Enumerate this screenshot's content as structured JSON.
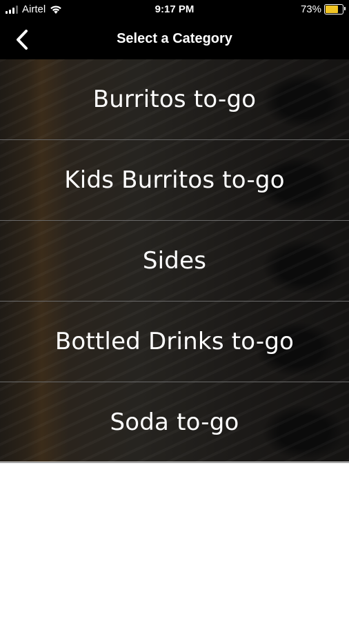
{
  "status_bar": {
    "carrier": "Airtel",
    "time": "9:17 PM",
    "battery_percent": "73%",
    "battery_level": 0.73,
    "battery_color": "#f2c524"
  },
  "nav": {
    "back_icon": "chevron-left-icon",
    "title": "Select a Category"
  },
  "categories": [
    {
      "label": "Burritos to-go"
    },
    {
      "label": "Kids Burritos to-go"
    },
    {
      "label": "Sides"
    },
    {
      "label": "Bottled Drinks to-go"
    },
    {
      "label": "Soda to-go"
    }
  ]
}
